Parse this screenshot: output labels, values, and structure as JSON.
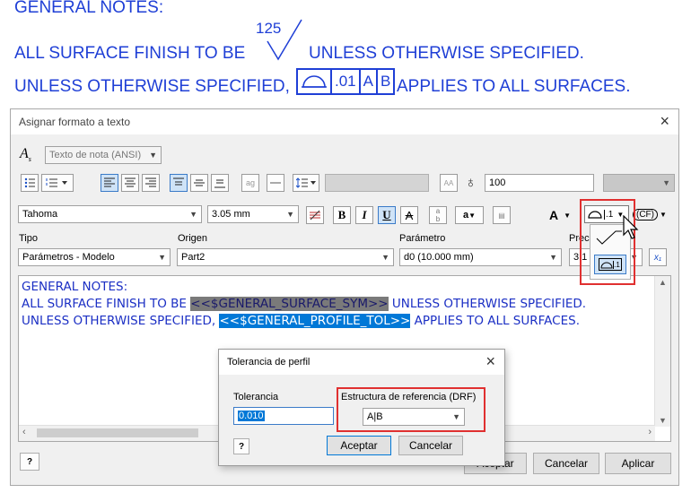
{
  "notes": {
    "heading": "GENERAL NOTES:",
    "line1_before": "ALL SURFACE FINISH TO BE",
    "surface_value": "125",
    "line1_after": "UNLESS OTHERWISE SPECIFIED.",
    "line2_before": "UNLESS OTHERWISE SPECIFIED,",
    "fcf_tol": ".01",
    "fcf_a": "A",
    "fcf_b": "B",
    "line2_after": "APPLIES TO ALL SURFACES."
  },
  "dialog": {
    "title": "Asignar formato a texto",
    "style_value": "Texto de nota (ANSI)",
    "scale_value": "100",
    "font_value": "Tahoma",
    "size_value": "3.05 mm",
    "btn_bold": "B",
    "btn_italic": "I",
    "btn_underline": "U",
    "btn_strike": "A",
    "btn_color": "A",
    "cf_label": "(CF)",
    "fcf_dropdown_label": ".1",
    "fcf_item_label": ".1",
    "tipo_label": "Tipo",
    "tipo_value": "Parámetros - Modelo",
    "origen_label": "Origen",
    "origen_value": "Part2",
    "param_label": "Parámetro",
    "param_value": "d0 (10.000 mm)",
    "prec_label": "Prec",
    "prec_value": "3.1",
    "text_line1": "GENERAL NOTES:",
    "text_line2_a": "ALL SURFACE FINISH TO BE ",
    "text_line2_sym": "<<$GENERAL_SURFACE_SYM>>",
    "text_line2_b": " UNLESS OTHERWISE SPECIFIED.",
    "text_line3_a": "UNLESS OTHERWISE SPECIFIED, ",
    "text_line3_sym": "<<$GENERAL_PROFILE_TOL>>",
    "text_line3_b": " APPLIES TO ALL SURFACES.",
    "ok_label": "Aceptar",
    "cancel_label": "Cancelar",
    "apply_label": "Aplicar"
  },
  "profile": {
    "title": "Tolerancia de perfil",
    "tol_label": "Tolerancia",
    "tol_value": "0.010",
    "drf_label": "Estructura de referencia (DRF)",
    "drf_value": "A|B",
    "ok_label": "Aceptar",
    "cancel_label": "Cancelar"
  },
  "colors": {
    "note_blue": "#1f3fd6",
    "highlight": "#0078d7",
    "callout_red": "#e03030"
  }
}
